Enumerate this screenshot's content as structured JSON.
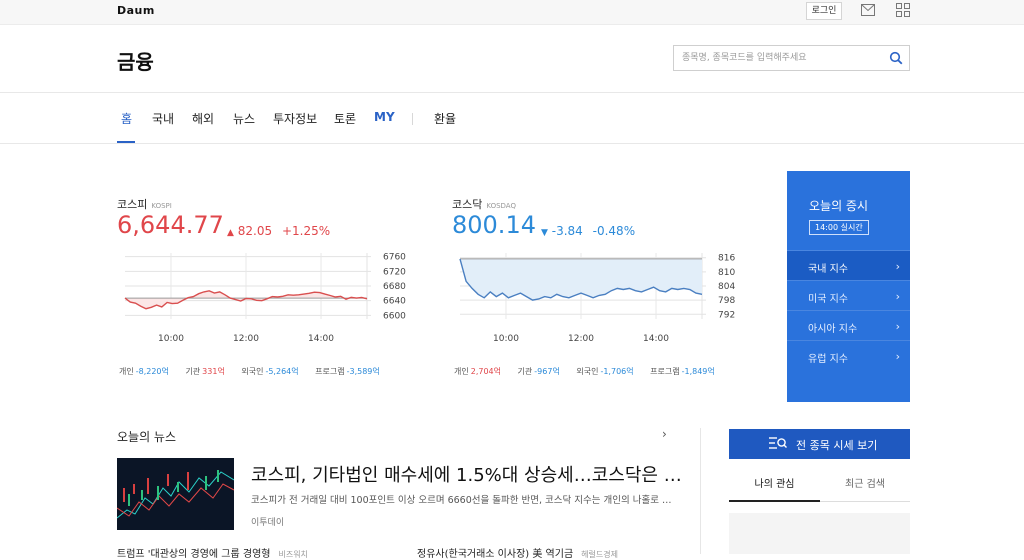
{
  "topbar": {
    "logo": "Daum",
    "login_label": "로그인",
    "icons": [
      "mail-icon",
      "apps-grid-icon"
    ]
  },
  "header": {
    "title": "금융",
    "search_placeholder": "종목명, 종목코드를 입력해주세요"
  },
  "nav": {
    "items": [
      {
        "label": "홈"
      },
      {
        "label": "국내"
      },
      {
        "label": "해외"
      },
      {
        "label": "뉴스"
      },
      {
        "label": "투자정보"
      },
      {
        "label": "토론"
      },
      {
        "label": "MY"
      },
      {
        "label": "환율"
      }
    ],
    "active": "홈"
  },
  "kospi": {
    "name": "코스피",
    "code": "KOSPI",
    "value": "6,644.77",
    "change": "82.05",
    "change_pct": "+1.25%",
    "direction": "up",
    "trade": {
      "individual_label": "개인",
      "individual_value": "-8,220억",
      "institution_label": "기관",
      "institution_value": "331억",
      "foreign_label": "외국인",
      "foreign_value": "-5,264억",
      "program_label": "프로그램",
      "program_value": "-3,589억"
    }
  },
  "kosdaq": {
    "name": "코스닥",
    "code": "KOSDAQ",
    "value": "800.14",
    "change": "-3.84",
    "change_pct": "-0.48%",
    "direction": "down",
    "trade": {
      "individual_label": "개인",
      "individual_value": "2,704억",
      "institution_label": "기관",
      "institution_value": "-967억",
      "foreign_label": "외국인",
      "foreign_value": "-1,706억",
      "program_label": "프로그램",
      "program_value": "-1,849억"
    }
  },
  "chart_data": [
    {
      "type": "line",
      "series": [
        {
          "values": [
            6647,
            6636,
            6633,
            6625,
            6618,
            6622,
            6628,
            6623,
            6635,
            6632,
            6633,
            6641,
            6648,
            6651,
            6659,
            6664,
            6667,
            6661,
            6664,
            6656,
            6647,
            6643,
            6639,
            6646,
            6645,
            6641,
            6640,
            6645,
            6651,
            6650,
            6652,
            6656,
            6655,
            6656,
            6658,
            6660,
            6663,
            6662,
            6658,
            6654,
            6650,
            6652,
            6644,
            6649,
            6647,
            6649,
            6645
          ]
        }
      ],
      "x": [
        "9:00",
        "9:09",
        "9:18",
        "9:27",
        "9:36",
        "9:45",
        "9:54",
        "10:03",
        "10:12",
        "10:21",
        "10:30",
        "10:39",
        "10:48",
        "10:57",
        "11:06",
        "11:15",
        "11:24",
        "11:33",
        "11:42",
        "11:51",
        "12:00",
        "12:09",
        "12:18",
        "12:27",
        "12:36",
        "12:45",
        "12:54",
        "13:03",
        "13:12",
        "13:21",
        "13:30",
        "13:39",
        "13:48",
        "13:57",
        "14:06",
        "14:15",
        "14:24",
        "14:33",
        "14:42",
        "14:51",
        "15:00",
        "15:09",
        "15:18",
        "15:27",
        "15:36",
        "15:45",
        "15:54"
      ],
      "x_ticks": [
        "10:00",
        "12:00",
        "14:00"
      ],
      "y_ticks": [
        6760,
        6720,
        6680,
        6640,
        6600
      ],
      "ylim": [
        6590,
        6770
      ],
      "color": "#d94f4f",
      "fill": "#fbe6e6"
    },
    {
      "type": "line",
      "series": [
        {
          "values": [
            815.5,
            806.0,
            803.0,
            800.5,
            799.0,
            801.5,
            799.5,
            801.0,
            799.0,
            800.0,
            801.0,
            799.5,
            798.0,
            798.5,
            799.5,
            799.0,
            800.5,
            799.5,
            799.0,
            800.0,
            801.0,
            800.0,
            799.0,
            800.0,
            800.5,
            802.0,
            803.0,
            802.5,
            803.0,
            802.0,
            801.5,
            802.5,
            803.5,
            802.0,
            801.5,
            803.0,
            802.5,
            803.0,
            802.5,
            801.0,
            800.5
          ]
        }
      ],
      "x": [
        "9:00",
        "9:10",
        "9:20",
        "9:30",
        "9:40",
        "9:50",
        "10:00",
        "10:10",
        "10:20",
        "10:30",
        "10:40",
        "10:50",
        "11:00",
        "11:10",
        "11:20",
        "11:30",
        "11:40",
        "11:50",
        "12:00",
        "12:10",
        "12:20",
        "12:30",
        "12:40",
        "12:50",
        "13:00",
        "13:10",
        "13:20",
        "13:30",
        "13:40",
        "13:50",
        "14:00",
        "14:10",
        "14:20",
        "14:30",
        "14:40",
        "14:50",
        "15:00",
        "15:10",
        "15:20",
        "15:30",
        "15:40"
      ],
      "x_ticks": [
        "10:00",
        "12:00",
        "14:00"
      ],
      "y_ticks": [
        816,
        810,
        804,
        798,
        792
      ],
      "ylim": [
        790,
        818
      ],
      "color": "#4a7fc1",
      "fill": "#e2eef9"
    }
  ],
  "market_panel": {
    "title": "오늘의 증시",
    "badge": "14:00 실시간",
    "items": [
      {
        "label": "국내 지수",
        "selected": true
      },
      {
        "label": "미국 지수",
        "selected": false
      },
      {
        "label": "아시아 지수",
        "selected": false
      },
      {
        "label": "유럽 지수",
        "selected": false
      }
    ]
  },
  "news": {
    "heading": "오늘의 뉴스",
    "title": "코스피, 기타법인 매수세에 1.5%대 상승세…코스닥은 …",
    "description": "코스피가 전 거래일 대비 100포인트 이상 오르며 6660선을 돌파한 반면, 코스닥 지수는 개인의 나홀로 …",
    "source": "이투데이",
    "rows": [
      {
        "title": "트럼프 '대관상의 경영에 그룹 경영형",
        "tag": "비즈워치"
      },
      {
        "title": "정유사(한국거래소 이사장) 美 역기금",
        "tag": "헤럴드경제"
      }
    ]
  },
  "right_col": {
    "all_button": "전 종목 시세 보기",
    "tab_mine": "나의 관심",
    "tab_recent": "최근 검색"
  }
}
